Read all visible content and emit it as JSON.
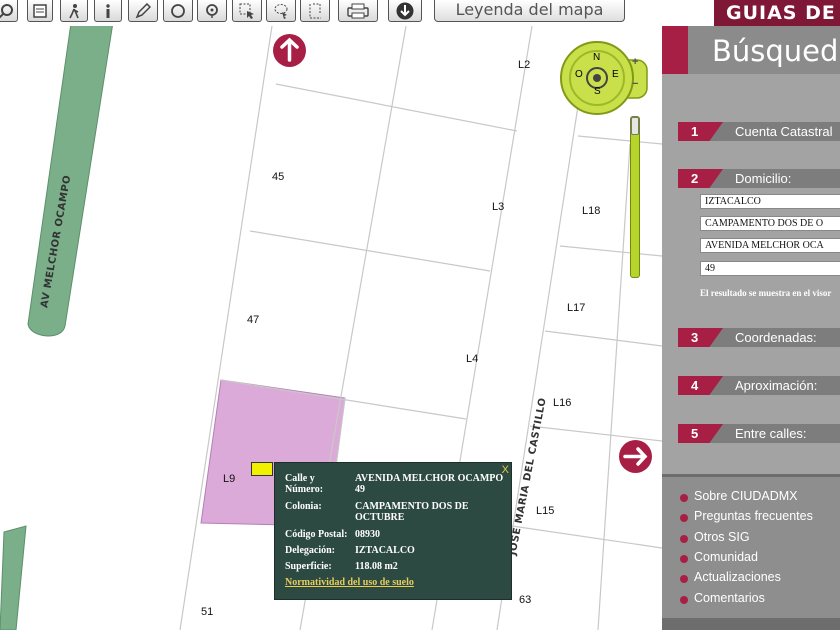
{
  "toolbar": {
    "buttons": [
      "zoom-icon",
      "page-icon",
      "walk-icon",
      "info-icon",
      "edit-icon",
      "circle-icon",
      "location-icon",
      "select-icon",
      "lasso-icon",
      "rectangle-icon",
      "print-icon",
      "download-icon"
    ],
    "legend_label": "Leyenda del mapa"
  },
  "map": {
    "street_labels": [
      "AV MELCHOR OCAMPO",
      "JOSE MARIA DEL CASTILLO"
    ],
    "lot_labels": {
      "l45": "45",
      "l47": "47",
      "l51": "51",
      "l63": "63",
      "L2": "L2",
      "L3": "L3",
      "L4": "L4",
      "L9": "L9",
      "L15": "L15",
      "L16": "L16",
      "L17": "L17",
      "L18": "L18"
    },
    "compass": {
      "n": "N",
      "s": "S",
      "e": "E",
      "o": "O",
      "plus": "+",
      "minus": "−"
    },
    "colors": {
      "highlight": "#dcaad8",
      "avenue": "#7aaf8a",
      "accent": "#a81f45"
    }
  },
  "popup": {
    "close": "X",
    "rows": [
      {
        "k": "Calle y Número:",
        "v": "AVENIDA MELCHOR OCAMPO 49"
      },
      {
        "k": "Colonia:",
        "v": "CAMPAMENTO DOS DE OCTUBRE"
      },
      {
        "k": "Código Postal:",
        "v": "08930"
      },
      {
        "k": "Delegación:",
        "v": "IZTACALCO"
      },
      {
        "k": "Superficie:",
        "v": "118.08 m2"
      }
    ],
    "link": "Normatividad del uso de suelo"
  },
  "panel": {
    "banner": "GUIAS DE",
    "title": "Búsqued",
    "sections": [
      {
        "num": "1",
        "label": "Cuenta Catastral"
      },
      {
        "num": "2",
        "label": "Domicilio:"
      },
      {
        "num": "3",
        "label": "Coordenadas:"
      },
      {
        "num": "4",
        "label": "Aproximación:"
      },
      {
        "num": "5",
        "label": "Entre calles:"
      }
    ],
    "fields": [
      "IZTACALCO",
      "CAMPAMENTO DOS DE O",
      "AVENIDA MELCHOR OCA",
      "49"
    ],
    "result_note": "El resultado se muestra en el visor",
    "links": [
      "Sobre CIUDADMX",
      "Preguntas frecuentes",
      "Otros SIG",
      "Comunidad",
      "Actualizaciones",
      "Comentarios"
    ]
  }
}
